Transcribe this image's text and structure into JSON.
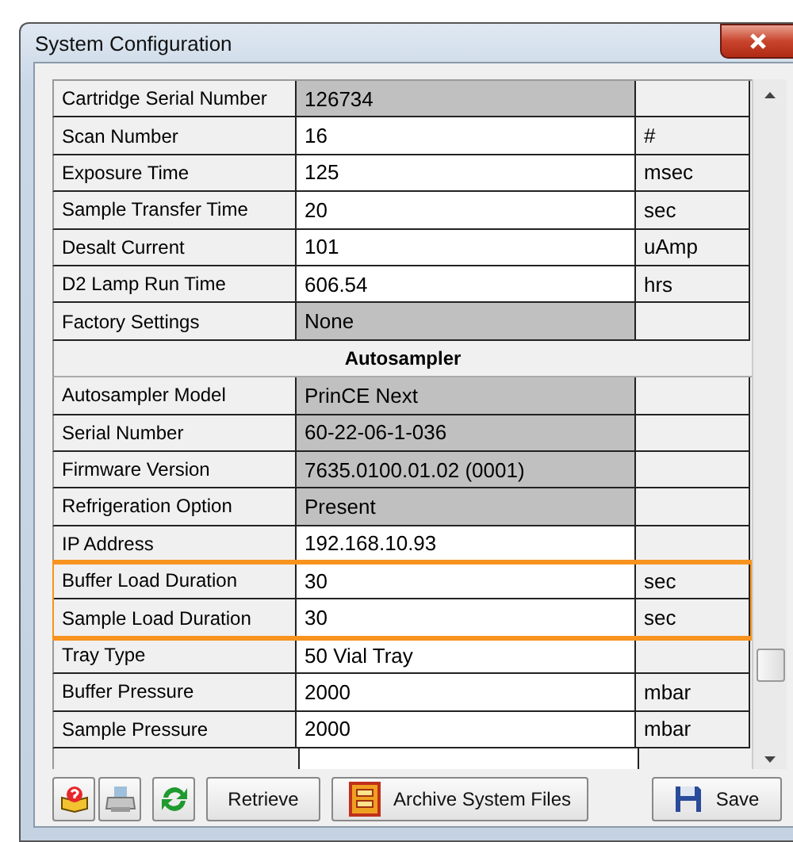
{
  "window": {
    "title": "System Configuration"
  },
  "rows": [
    {
      "kind": "field",
      "label": "Cartridge Serial Number",
      "value": "126734",
      "readonly": true,
      "highlighted": false
    },
    {
      "kind": "field",
      "label": "Scan Number",
      "value": "16",
      "unit": "#",
      "readonly": false,
      "highlighted": false
    },
    {
      "kind": "field",
      "label": "Exposure Time",
      "value": "125",
      "unit": "msec",
      "readonly": false,
      "highlighted": false
    },
    {
      "kind": "field",
      "label": "Sample Transfer Time",
      "value": "20",
      "unit": "sec",
      "readonly": false,
      "highlighted": false
    },
    {
      "kind": "field",
      "label": "Desalt Current",
      "value": "101",
      "unit": "uAmp",
      "readonly": false,
      "highlighted": false
    },
    {
      "kind": "field",
      "label": "D2 Lamp Run Time",
      "value": "606.54",
      "unit": "hrs",
      "readonly": false,
      "highlighted": false
    },
    {
      "kind": "field",
      "label": "Factory Settings",
      "value": "None",
      "readonly": true,
      "highlighted": false
    },
    {
      "kind": "section",
      "label": "Autosampler"
    },
    {
      "kind": "field",
      "label": "Autosampler Model",
      "value": "PrinCE Next",
      "readonly": true,
      "highlighted": false
    },
    {
      "kind": "field",
      "label": "Serial Number",
      "value": "60-22-06-1-036",
      "readonly": true,
      "highlighted": false
    },
    {
      "kind": "field",
      "label": "Firmware Version",
      "value": "7635.0100.01.02 (0001)",
      "readonly": true,
      "highlighted": false
    },
    {
      "kind": "field",
      "label": "Refrigeration Option",
      "value": "Present",
      "readonly": true,
      "highlighted": false
    },
    {
      "kind": "field",
      "label": "IP Address",
      "value": "192.168.10.93",
      "readonly": false,
      "highlighted": false
    },
    {
      "kind": "field",
      "label": "Buffer Load Duration",
      "value": "30",
      "unit": "sec",
      "readonly": false,
      "highlighted": true
    },
    {
      "kind": "field",
      "label": "Sample Load Duration",
      "value": "30",
      "unit": "sec",
      "readonly": false,
      "highlighted": true
    },
    {
      "kind": "field",
      "label": "Tray Type",
      "value": "50 Vial Tray",
      "readonly": false,
      "highlighted": false
    },
    {
      "kind": "field",
      "label": "Buffer Pressure",
      "value": "2000",
      "unit": "mbar",
      "readonly": false,
      "highlighted": false
    },
    {
      "kind": "field",
      "label": "Sample Pressure",
      "value": "2000",
      "unit": "mbar",
      "readonly": false,
      "highlighted": false
    }
  ],
  "buttons": [
    {
      "kind": "help"
    },
    {
      "kind": "print"
    },
    {
      "kind": "refresh"
    },
    {
      "kind": "text",
      "label": "Retrieve"
    },
    {
      "kind": "archive",
      "label": "Archive System Files"
    },
    {
      "kind": "save",
      "label": "Save"
    }
  ]
}
